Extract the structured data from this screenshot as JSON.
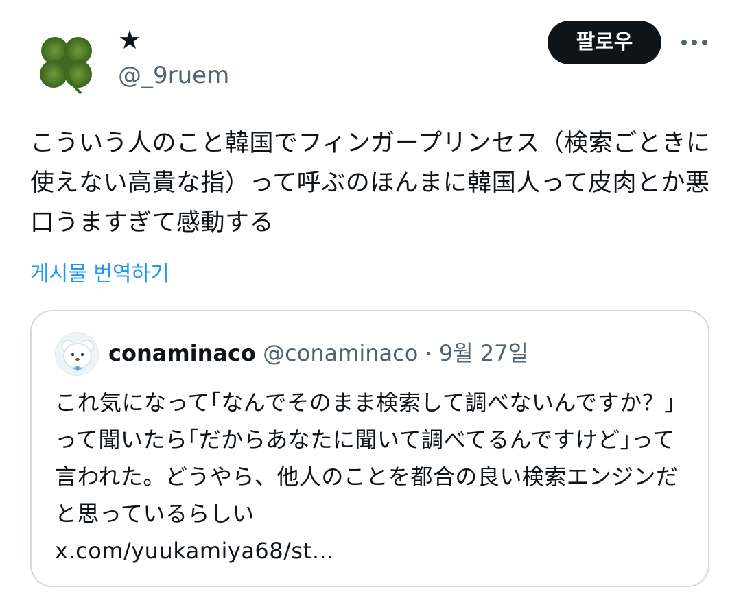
{
  "tweet": {
    "display_name": "★",
    "handle": "@_9ruem",
    "follow_label": "팔로우",
    "text": "こういう人のこと韓国でフィンガープリンセス（検索ごときに使えない高貴な指）って呼ぶのほんまに韓国人って皮肉とか悪口うますぎて感動する",
    "translate_label": "게시물 번역하기"
  },
  "quote": {
    "name": "conaminaco",
    "handle": "@conaminaco",
    "separator": "·",
    "date": "9월 27일",
    "text": "これ気になって｢なんでそのまま検索して調べないんですか？｣って聞いたら｢だからあなたに聞いて調べてるんですけど｣って言われた。どうやら、他人のことを都合の良い検索エンジンだと思っているらしい",
    "link": "x.com/yuukamiya68/st…"
  },
  "icons": {
    "avatar": "four-leaf-clover-icon",
    "quote_avatar": "white-bear-icon",
    "more": "more-options-icon"
  },
  "colors": {
    "text": "#0f1419",
    "secondary": "#536471",
    "link": "#1d9bf0",
    "border": "#cfd9de",
    "button": "#0f1419"
  }
}
